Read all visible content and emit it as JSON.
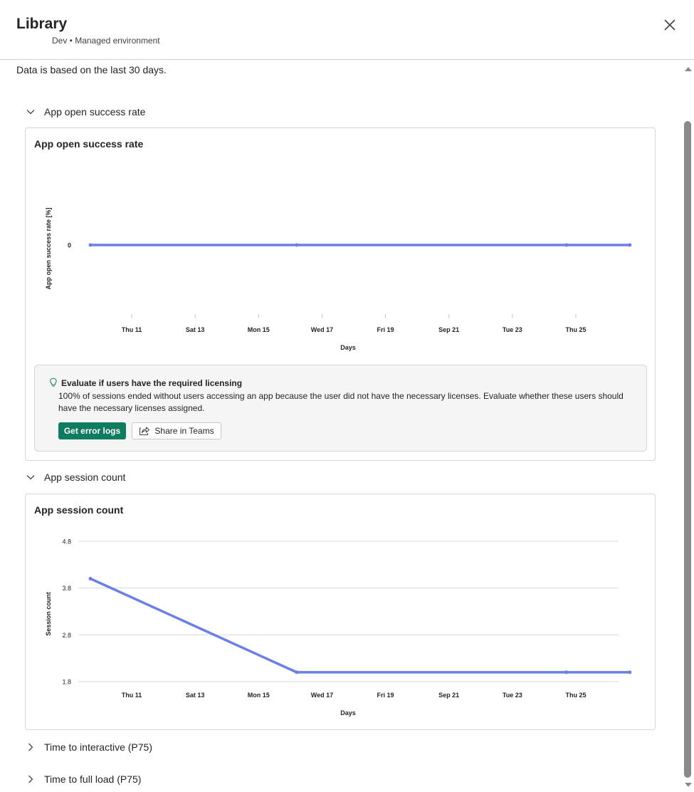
{
  "header": {
    "title": "Library",
    "subtitle": "Dev • Managed environment",
    "close_icon": "close-icon"
  },
  "note": "Data is based on the last 30 days.",
  "sections": {
    "open_rate": {
      "label": "App open success rate",
      "expanded": true
    },
    "session_count": {
      "label": "App session count",
      "expanded": true
    },
    "time_interactive": {
      "label": "Time to interactive (P75)",
      "expanded": false
    },
    "time_full_load": {
      "label": "Time to full load (P75)",
      "expanded": false
    }
  },
  "insight": {
    "icon": "lightbulb-icon",
    "title": "Evaluate if users have the required licensing",
    "body": "100% of sessions ended without users accessing an app because the user did not have the necessary licenses. Evaluate whether these users should have the necessary licenses assigned.",
    "primary_button": "Get error logs",
    "secondary_button": "Share in Teams",
    "primary_color": "#0f7b5f"
  },
  "chart_data": [
    {
      "type": "line",
      "title": "App open success rate",
      "xlabel": "Days",
      "ylabel": "App open success rate [%]",
      "x_ticks": [
        "Thu 11",
        "Sat 13",
        "Mon 15",
        "Wed 17",
        "Fri 19",
        "Sep 21",
        "Tue 23",
        "Thu 25"
      ],
      "y_ticks": [
        "0"
      ],
      "grid": false,
      "line_color": "#6b7fe8",
      "series": [
        {
          "x": [
            9.7,
            16.2,
            24.7,
            26.7
          ],
          "y": [
            0,
            0,
            0,
            0
          ]
        }
      ]
    },
    {
      "type": "line",
      "title": "App session count",
      "xlabel": "Days",
      "ylabel": "Session count",
      "x_ticks": [
        "Thu 11",
        "Sat 13",
        "Mon 15",
        "Wed 17",
        "Fri 19",
        "Sep 21",
        "Tue 23",
        "Thu 25"
      ],
      "y_ticks": [
        "4.8",
        "3.8",
        "2.8",
        "1.8"
      ],
      "ylim": [
        1.8,
        4.8
      ],
      "grid": true,
      "line_color": "#6b7fe8",
      "series": [
        {
          "x": [
            9.7,
            16.2,
            24.7,
            26.7
          ],
          "y": [
            4,
            2,
            2,
            2
          ]
        }
      ]
    }
  ]
}
